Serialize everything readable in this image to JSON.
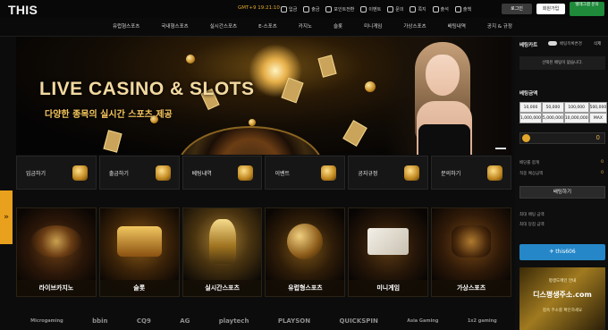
{
  "header": {
    "logo": "THIS",
    "gmt": "GMT+9 19:21:10",
    "links": [
      {
        "label": "입금",
        "icon": "deposit-icon"
      },
      {
        "label": "출금",
        "icon": "withdraw-icon"
      },
      {
        "label": "포인트전환",
        "icon": "point-icon"
      },
      {
        "label": "이벤트",
        "icon": "gift-icon"
      },
      {
        "label": "문의",
        "icon": "chat-icon"
      },
      {
        "label": "쪽지",
        "icon": "mail-icon"
      },
      {
        "label": "출석",
        "icon": "calendar-icon"
      },
      {
        "label": "출첵",
        "icon": "check-icon"
      }
    ],
    "login_label": "로그인",
    "join_label": "회원가입",
    "telegram_label": "텔레그램 문의"
  },
  "nav": [
    "유럽형스포츠",
    "국내형스포츠",
    "실시간스포츠",
    "E-스포츠",
    "카지노",
    "슬롯",
    "미니게임",
    "가상스포츠",
    "배팅내역",
    "공지 & 규정"
  ],
  "banner": {
    "title": "LIVE CASINO & SLOTS",
    "subtitle": "다양한 종목의 실시간 스포츠 제공"
  },
  "quick": [
    "입금하기",
    "출금하기",
    "베팅내역",
    "이벤트",
    "공지규정",
    "문의하기"
  ],
  "games": [
    "라이브카지노",
    "슬롯",
    "실시간스포츠",
    "유럽형스포츠",
    "미니게임",
    "가상스포츠"
  ],
  "providers": [
    "Microgaming",
    "bbin",
    "CQ9",
    "AG",
    "playtech",
    "PLAYSON",
    "QUICKSPIN",
    "Asia Gaming",
    "1x2 gaming"
  ],
  "betslip": {
    "title": "베팅카트",
    "toggle_label": "베팅목록변경",
    "delete_label": "삭제",
    "empty_text": "선택된 배팅이 없습니다.",
    "amount_title": "베팅금액",
    "amounts": [
      "10,000",
      "50,000",
      "100,000",
      "500,000",
      "1,000,000",
      "5,000,000",
      "10,000,000",
      "MAX"
    ],
    "amount_value": "0",
    "rows": [
      {
        "label": "배당률 합계",
        "value": "0"
      },
      {
        "label": "적중 예상금액",
        "value": "0"
      }
    ],
    "bet_button": "배팅하기",
    "info": [
      "최대 배팅 금액",
      "최대 당첨 금액"
    ],
    "telegram_id": "this606",
    "ad": {
      "line1": "평생도메인 안내",
      "line2": "디스평생주소.com",
      "line3": "접속 주소를 확인하세요"
    }
  }
}
